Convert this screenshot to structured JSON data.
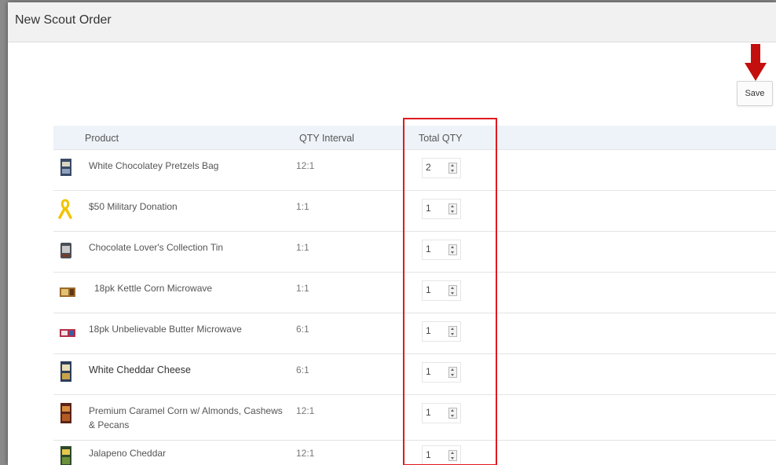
{
  "window": {
    "title": "New Scout Order"
  },
  "toolbar": {
    "save_label": "Save"
  },
  "table": {
    "headers": {
      "product": "Product",
      "interval": "QTY Interval",
      "total": "Total QTY"
    },
    "rows": [
      {
        "name": "White Chocolatey Pretzels Bag",
        "interval": "12:1",
        "qty": "2",
        "icon": "pretzel-bag-icon"
      },
      {
        "name": "$50 Military Donation",
        "interval": "1:1",
        "qty": "1",
        "icon": "yellow-ribbon-icon"
      },
      {
        "name": "Chocolate Lover's Collection Tin",
        "interval": "1:1",
        "qty": "1",
        "icon": "chocolate-tin-icon"
      },
      {
        "name": "18pk Kettle Corn Microwave",
        "interval": "1:1",
        "qty": "1",
        "icon": "kettle-corn-box-icon"
      },
      {
        "name": "18pk Unbelievable Butter Microwave",
        "interval": "6:1",
        "qty": "1",
        "icon": "butter-popcorn-box-icon"
      },
      {
        "name": "White Cheddar Cheese",
        "interval": "6:1",
        "qty": "1",
        "icon": "white-cheddar-bag-icon"
      },
      {
        "name": "Premium Caramel Corn w/ Almonds, Cashews & Pecans",
        "interval": "12:1",
        "qty": "1",
        "icon": "caramel-corn-bag-icon"
      },
      {
        "name": "Jalapeno Cheddar",
        "interval": "12:1",
        "qty": "1",
        "icon": "jalapeno-cheddar-bag-icon"
      }
    ]
  },
  "annotations": {
    "highlight_color": "#e0191f",
    "arrow_color": "#c40f0f"
  }
}
